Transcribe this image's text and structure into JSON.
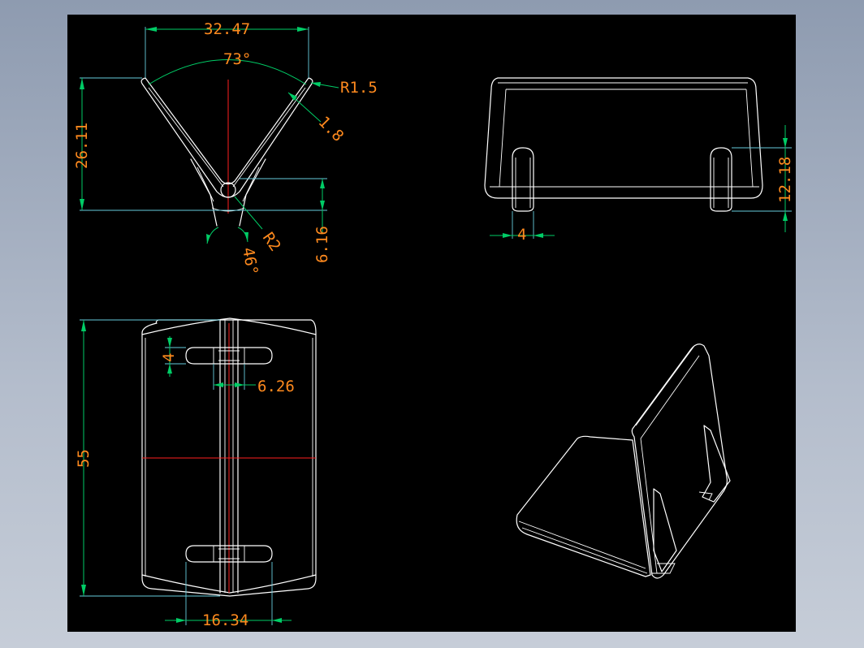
{
  "colors": {
    "background": "#000000",
    "geometry": "#ffffff",
    "dimension_line": "#00cc66",
    "extension_line": "#66ccdd",
    "center_line": "#ff2020",
    "dimension_text": "#ff8a1e"
  },
  "front_view": {
    "dim_top_width": "32.47",
    "dim_angle_top": "73°",
    "dim_radius_tip": "R1.5",
    "dim_thickness": "1.8",
    "dim_height": "26.11",
    "dim_base_height": "6.16",
    "dim_radius_root": "R2",
    "dim_angle_bottom": "46°"
  },
  "side_view": {
    "dim_height": "12.18",
    "dim_foot_width": "4"
  },
  "top_view": {
    "dim_length": "55",
    "dim_slot_width": "4",
    "dim_slot_length": "6.26",
    "dim_foot_span": "16.34"
  }
}
